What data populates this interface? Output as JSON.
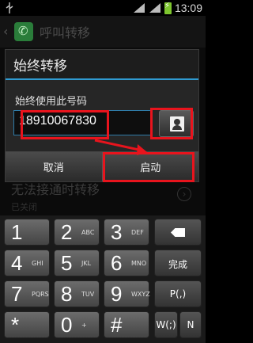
{
  "status_bar": {
    "time": "13:09"
  },
  "action_bar": {
    "title": "呼叫转移"
  },
  "background_item": {
    "title": "无法接通时转移",
    "subtitle": "已关闭",
    "chevron": "›"
  },
  "dialog": {
    "title": "始终转移",
    "label": "始终使用此号码",
    "number_value": "18910067830",
    "cancel_label": "取消",
    "start_label": "启动"
  },
  "keypad": {
    "keys": [
      {
        "num": "1",
        "letters": ""
      },
      {
        "num": "2",
        "letters": "ABC"
      },
      {
        "num": "3",
        "letters": "DEF"
      },
      {
        "num": "4",
        "letters": "GHI"
      },
      {
        "num": "5",
        "letters": "JKL"
      },
      {
        "num": "6",
        "letters": "MNO"
      },
      {
        "num": "7",
        "letters": "PQRS"
      },
      {
        "num": "8",
        "letters": "TUV"
      },
      {
        "num": "9",
        "letters": "WXYZ"
      },
      {
        "num": "*",
        "letters": ""
      },
      {
        "num": "0",
        "letters": "+"
      },
      {
        "num": "#",
        "letters": ""
      }
    ],
    "done_label": "完成",
    "p_label": "P(,)",
    "w_label": "W(;)",
    "n_label": "N"
  },
  "colors": {
    "accent": "#2f9bd1",
    "annotation": "#e8141d"
  }
}
